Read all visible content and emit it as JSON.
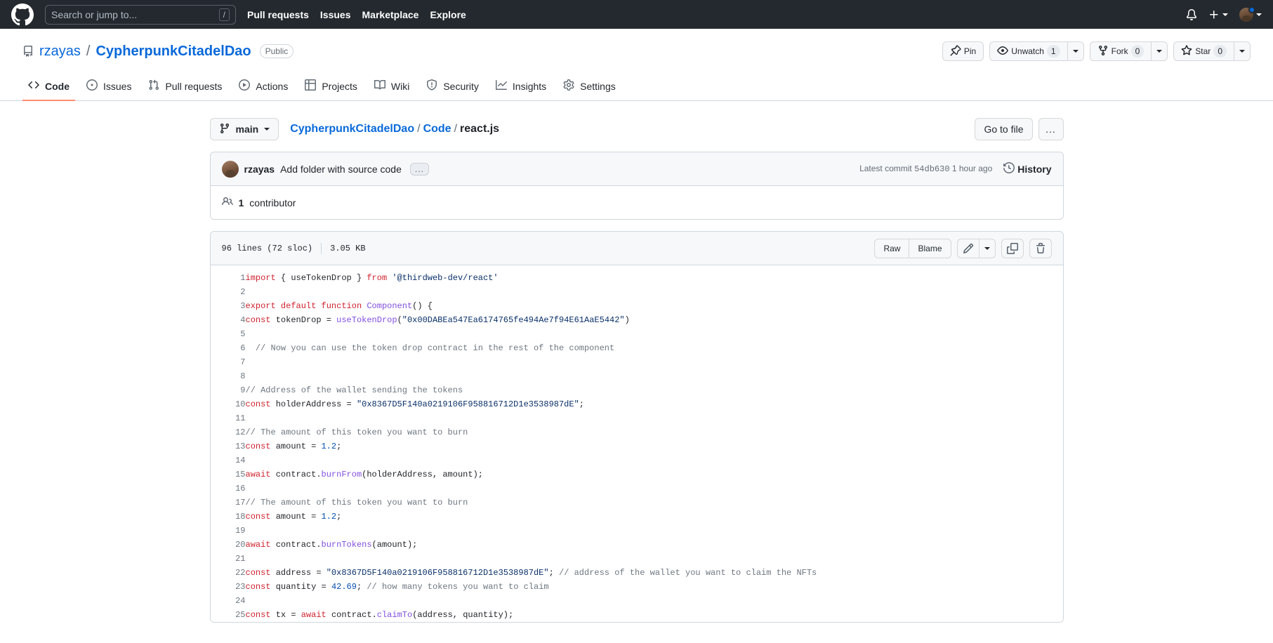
{
  "global_header": {
    "logo": "github-mark-icon",
    "search": {
      "placeholder": "Search or jump to...",
      "shortcut": "/"
    },
    "nav": [
      {
        "label": "Pull requests"
      },
      {
        "label": "Issues"
      },
      {
        "label": "Marketplace"
      },
      {
        "label": "Explore"
      }
    ],
    "notifications_icon": "bell-icon",
    "create_new_icon": "plus-icon",
    "avatar_icon": "user-avatar"
  },
  "repo": {
    "icon": "repo-icon",
    "owner": "rzayas",
    "separator": "/",
    "name": "CypherpunkCitadelDao",
    "visibility": "Public",
    "actions": {
      "pin": {
        "label": "Pin",
        "icon": "pin-icon"
      },
      "watch": {
        "label": "Unwatch",
        "count": "1",
        "icon": "eye-icon"
      },
      "fork": {
        "label": "Fork",
        "count": "0",
        "icon": "fork-icon"
      },
      "star": {
        "label": "Star",
        "count": "0",
        "icon": "star-icon"
      }
    },
    "tabs": [
      {
        "label": "Code",
        "icon": "code-icon",
        "active": true
      },
      {
        "label": "Issues",
        "icon": "issue-opened-icon",
        "active": false
      },
      {
        "label": "Pull requests",
        "icon": "git-pull-request-icon",
        "active": false
      },
      {
        "label": "Actions",
        "icon": "play-icon",
        "active": false
      },
      {
        "label": "Projects",
        "icon": "table-icon",
        "active": false
      },
      {
        "label": "Wiki",
        "icon": "book-icon",
        "active": false
      },
      {
        "label": "Security",
        "icon": "shield-icon",
        "active": false
      },
      {
        "label": "Insights",
        "icon": "graph-icon",
        "active": false
      },
      {
        "label": "Settings",
        "icon": "gear-icon",
        "active": false
      }
    ]
  },
  "file_nav": {
    "branch": {
      "label": "main",
      "icon": "git-branch-icon"
    },
    "breadcrumb": {
      "repo": "CypherpunkCitadelDao",
      "sep1": "/",
      "folder": "Code",
      "sep2": "/",
      "file": "react.js"
    },
    "go_to_file": "Go to file",
    "more_button": "...",
    "more_icon": "kebab-horizontal-icon"
  },
  "commit": {
    "author": "rzayas",
    "message": "Add folder with source code",
    "expand_button": "...",
    "latest_commit_label": "Latest commit",
    "sha": "54db630",
    "time": "1 hour ago",
    "history_label": "History",
    "history_icon": "history-icon",
    "contributors_count": "1",
    "contributors_label": "contributor",
    "contributors_icon": "people-icon"
  },
  "file": {
    "lines": "96 lines (72 sloc)",
    "size": "3.05 KB",
    "raw_button": "Raw",
    "blame_button": "Blame",
    "edit_icon": "pencil-icon",
    "edit_caret_icon": "chevron-down-icon",
    "copy_icon": "copy-icon",
    "delete_icon": "trash-icon"
  },
  "code_lines": [
    {
      "n": "1",
      "tokens": [
        {
          "t": "import ",
          "c": "k"
        },
        {
          "t": "{ useTokenDrop } ",
          "c": ""
        },
        {
          "t": "from ",
          "c": "k"
        },
        {
          "t": "'@thirdweb-dev/react'",
          "c": "s"
        }
      ]
    },
    {
      "n": "2",
      "tokens": []
    },
    {
      "n": "3",
      "tokens": [
        {
          "t": "export ",
          "c": "k"
        },
        {
          "t": "default ",
          "c": "k"
        },
        {
          "t": "function ",
          "c": "k"
        },
        {
          "t": "Component",
          "c": "f"
        },
        {
          "t": "() {",
          "c": ""
        }
      ]
    },
    {
      "n": "4",
      "tokens": [
        {
          "t": "const ",
          "c": "k"
        },
        {
          "t": "tokenDrop = ",
          "c": ""
        },
        {
          "t": "useTokenDrop",
          "c": "f"
        },
        {
          "t": "(",
          "c": ""
        },
        {
          "t": "\"0x00DABEa547Ea6174765fe494Ae7f94E61AaE5442\"",
          "c": "s"
        },
        {
          "t": ")",
          "c": ""
        }
      ]
    },
    {
      "n": "5",
      "tokens": []
    },
    {
      "n": "6",
      "tokens": [
        {
          "t": "  // Now you can use the token drop contract in the rest of the component",
          "c": "c"
        }
      ]
    },
    {
      "n": "7",
      "tokens": []
    },
    {
      "n": "8",
      "tokens": []
    },
    {
      "n": "9",
      "tokens": [
        {
          "t": "// Address of the wallet sending the tokens",
          "c": "c"
        }
      ]
    },
    {
      "n": "10",
      "tokens": [
        {
          "t": "const ",
          "c": "k"
        },
        {
          "t": "holderAddress = ",
          "c": ""
        },
        {
          "t": "\"0x8367D5F140a0219106F958816712D1e3538987dE\"",
          "c": "s"
        },
        {
          "t": ";",
          "c": ""
        }
      ]
    },
    {
      "n": "11",
      "tokens": []
    },
    {
      "n": "12",
      "tokens": [
        {
          "t": "// The amount of this token you want to burn",
          "c": "c"
        }
      ]
    },
    {
      "n": "13",
      "tokens": [
        {
          "t": "const ",
          "c": "k"
        },
        {
          "t": "amount = ",
          "c": ""
        },
        {
          "t": "1.2",
          "c": "n"
        },
        {
          "t": ";",
          "c": ""
        }
      ]
    },
    {
      "n": "14",
      "tokens": []
    },
    {
      "n": "15",
      "tokens": [
        {
          "t": "await ",
          "c": "k"
        },
        {
          "t": "contract.",
          "c": ""
        },
        {
          "t": "burnFrom",
          "c": "f"
        },
        {
          "t": "(holderAddress, amount);",
          "c": ""
        }
      ]
    },
    {
      "n": "16",
      "tokens": []
    },
    {
      "n": "17",
      "tokens": [
        {
          "t": "// The amount of this token you want to burn",
          "c": "c"
        }
      ]
    },
    {
      "n": "18",
      "tokens": [
        {
          "t": "const ",
          "c": "k"
        },
        {
          "t": "amount = ",
          "c": ""
        },
        {
          "t": "1.2",
          "c": "n"
        },
        {
          "t": ";",
          "c": ""
        }
      ]
    },
    {
      "n": "19",
      "tokens": []
    },
    {
      "n": "20",
      "tokens": [
        {
          "t": "await ",
          "c": "k"
        },
        {
          "t": "contract.",
          "c": ""
        },
        {
          "t": "burnTokens",
          "c": "f"
        },
        {
          "t": "(amount);",
          "c": ""
        }
      ]
    },
    {
      "n": "21",
      "tokens": []
    },
    {
      "n": "22",
      "tokens": [
        {
          "t": "const ",
          "c": "k"
        },
        {
          "t": "address = ",
          "c": ""
        },
        {
          "t": "\"0x8367D5F140a0219106F958816712D1e3538987dE\"",
          "c": "s"
        },
        {
          "t": "; ",
          "c": ""
        },
        {
          "t": "// address of the wallet you want to claim the NFTs",
          "c": "c"
        }
      ]
    },
    {
      "n": "23",
      "tokens": [
        {
          "t": "const ",
          "c": "k"
        },
        {
          "t": "quantity = ",
          "c": ""
        },
        {
          "t": "42.69",
          "c": "n"
        },
        {
          "t": "; ",
          "c": ""
        },
        {
          "t": "// how many tokens you want to claim",
          "c": "c"
        }
      ]
    },
    {
      "n": "24",
      "tokens": []
    },
    {
      "n": "25",
      "tokens": [
        {
          "t": "const ",
          "c": "k"
        },
        {
          "t": "tx = ",
          "c": ""
        },
        {
          "t": "await ",
          "c": "k"
        },
        {
          "t": "contract.",
          "c": ""
        },
        {
          "t": "claimTo",
          "c": "f"
        },
        {
          "t": "(address, quantity);",
          "c": ""
        }
      ]
    }
  ]
}
